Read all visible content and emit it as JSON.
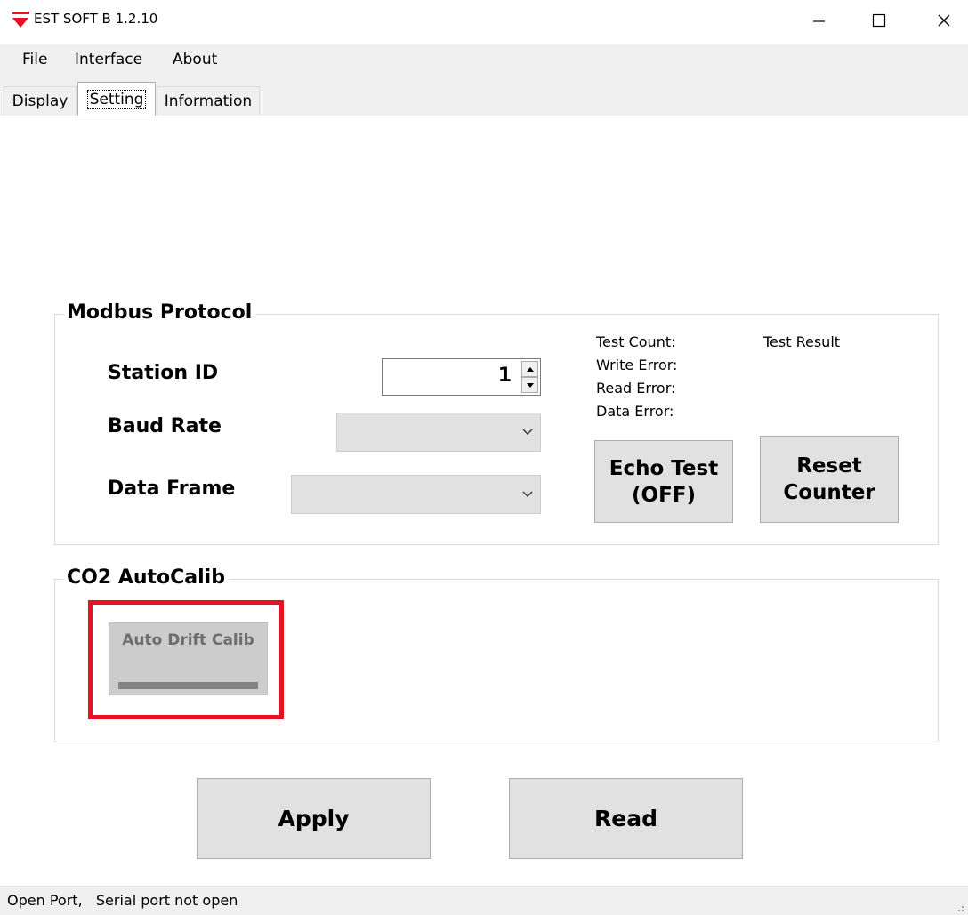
{
  "window": {
    "title": "EST SOFT B 1.2.10",
    "controls": [
      "minimize-icon",
      "maximize-icon",
      "close-icon"
    ]
  },
  "menu": {
    "items": [
      {
        "label": "File"
      },
      {
        "label": "Interface"
      },
      {
        "label": "About"
      }
    ]
  },
  "tabs": [
    {
      "label": "Display",
      "active": false
    },
    {
      "label": "Setting",
      "active": true
    },
    {
      "label": "Information",
      "active": false
    }
  ],
  "modbus": {
    "title": "Modbus Protocol",
    "station_id_label": "Station ID",
    "station_id_value": "1",
    "baud_rate_label": "Baud Rate",
    "baud_rate_value": "",
    "data_frame_label": "Data Frame",
    "data_frame_value": "",
    "test_count_label": "Test Count:",
    "test_result_label": "Test Result",
    "write_error_label": "Write Error:",
    "read_error_label": "Read Error:",
    "data_error_label": "Data Error:",
    "echo_test_line1": "Echo Test",
    "echo_test_line2": "(OFF)",
    "reset_line1": "Reset",
    "reset_line2": "Counter"
  },
  "autocalib": {
    "title": "CO2 AutoCalib",
    "button_label": "Auto Drift Calib",
    "highlight_color": "#e81123"
  },
  "actions": {
    "apply_label": "Apply",
    "read_label": "Read"
  },
  "status": {
    "text": "Open Port,   Serial port not open"
  },
  "colors": {
    "accent_red": "#e81123",
    "button_face": "#e1e1e1",
    "chrome": "#f0f0f0"
  }
}
